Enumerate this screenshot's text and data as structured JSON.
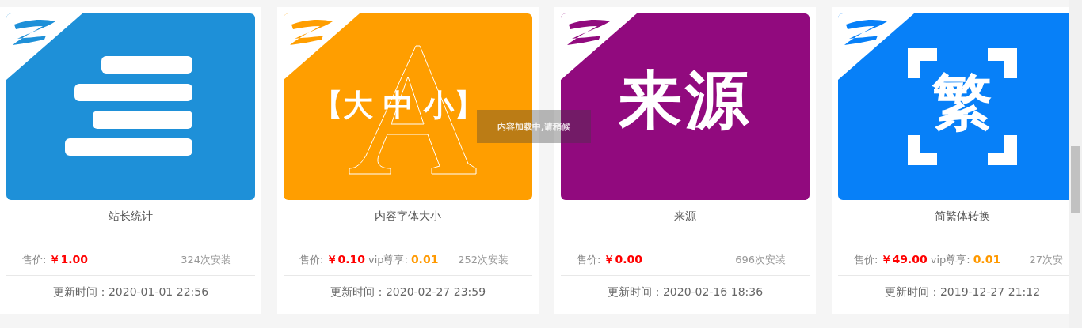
{
  "plugins": [
    {
      "title": "站长统计",
      "color": "#1e90d8",
      "image": {
        "kind": "bars"
      },
      "price_label": "售价:",
      "price": "￥1.00",
      "installs": "324次安装",
      "updated": "更新时间：2020-01-01 22:56"
    },
    {
      "title": "内容字体大小",
      "color": "#ff9e00",
      "image": {
        "kind": "letter",
        "text": "【大 中 小】"
      },
      "price_label": "售价:",
      "price": "￥0.10",
      "vip_label": "vip尊享:",
      "vip_price": "0.01",
      "installs": "252次安装",
      "updated": "更新时间：2020-02-27 23:59"
    },
    {
      "title": "来源",
      "color": "#910a7e",
      "image": {
        "kind": "text",
        "text": "来源"
      },
      "price_label": "售价:",
      "price": "￥0.00",
      "installs": "696次安装",
      "updated": "更新时间：2020-02-16 18:36"
    },
    {
      "title": "简繁体转换",
      "color": "#0780f8",
      "image": {
        "kind": "bracket",
        "text": "繁"
      },
      "price_label": "售价:",
      "price": "￥49.00",
      "vip_label": "vip尊享:",
      "vip_price": "0.01",
      "installs": "27次安",
      "updated": "更新时间：2019-12-27 21:12"
    }
  ],
  "loading_toast": "内容加载中,请稍候"
}
